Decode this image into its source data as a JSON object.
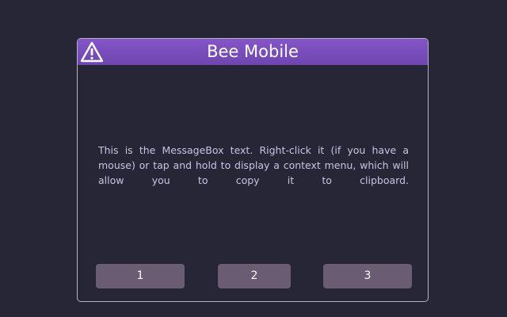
{
  "dialog": {
    "title": "Bee Mobile",
    "icon": "warning-icon",
    "message": "This is the MessageBox text. Right-click it (if you have a mouse) or tap and hold to display a context menu, which will allow you to copy it to clipboard.",
    "buttons": [
      {
        "label": "1"
      },
      {
        "label": "2"
      },
      {
        "label": "3"
      }
    ]
  },
  "colors": {
    "background": "#272637",
    "titlebar": "#7a4fbf",
    "button": "#6a5c72",
    "message_text": "#c9c3e2",
    "border": "#b7b3c7"
  }
}
